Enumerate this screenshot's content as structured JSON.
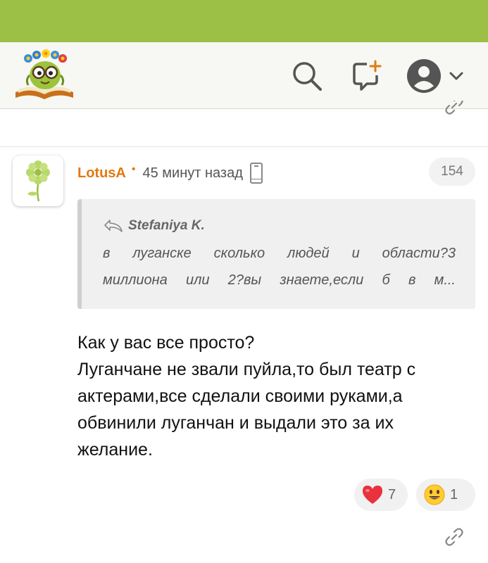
{
  "header": {
    "logo_alt": "site logo",
    "search_icon": "search-icon",
    "add_icon": "add-post-icon",
    "avatar_icon": "user-avatar-icon",
    "menu_icon": "chevron-down-icon"
  },
  "comment": {
    "author": "LotusA",
    "separator": "•",
    "time": "45 минут назад",
    "device_icon": "mobile-phone-icon",
    "count": "154",
    "quote": {
      "author": "Stefaniya K.",
      "lines": [
        "в луганске сколько людей и области?3",
        "миллиона или 2?вы знаете,если б в м..."
      ]
    },
    "body_lines": [
      "Как у вас все просто?",
      "Луганчане не звали пуйла,то был театр с",
      "актерами,все сделали своими руками,а",
      "обвинили луганчан и выдали это за их",
      "желание."
    ],
    "reactions": [
      {
        "icon": "heart-emoji-icon",
        "count": "7"
      },
      {
        "icon": "smile-emoji-icon",
        "count": "1"
      }
    ]
  },
  "colors": {
    "top_bar": "#9cbf45",
    "username": "#e07a10",
    "header_bg": "#f7f7f3"
  }
}
